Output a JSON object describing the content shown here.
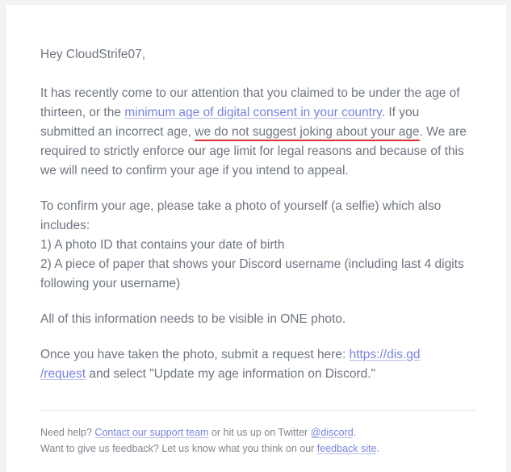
{
  "greeting": "Hey CloudStrife07,",
  "p1_a": "It has recently come to our attention that you claimed to be under the age of thirteen, or the ",
  "link_minage": "minimum age of digital consent in your country",
  "p1_b": ". If you submitted an incorrect age, ",
  "underlined": "we do not suggest joking about your age",
  "p1_c": ". We are required to strictly enforce our age limit for legal reasons and because of this we will need to confirm your age if you intend to appeal.",
  "p2_intro": "To confirm your age, please take a photo of yourself (a selfie) which also includes:",
  "p2_item1": "1) A photo ID that contains your date of birth",
  "p2_item2": "2) A piece of paper that shows your Discord username (including last 4 digits following your username)",
  "p3": "All of this information needs to be visible in ONE photo.",
  "p4_a": "Once you have taken the photo, submit a request here: ",
  "link_request_1": "https://dis.gd",
  "link_request_2": "/request",
  "p4_b": " and select \"Update my age information on Discord.\"",
  "footer": {
    "line1_a": "Need help? ",
    "link_support": "Contact our support team",
    "line1_b": " or hit us up on Twitter ",
    "link_twitter": "@discord",
    "line1_c": ".",
    "line2_a": "Want to give us feedback? Let us know what you think on our ",
    "link_feedback": "feedback site",
    "line2_b": "."
  }
}
